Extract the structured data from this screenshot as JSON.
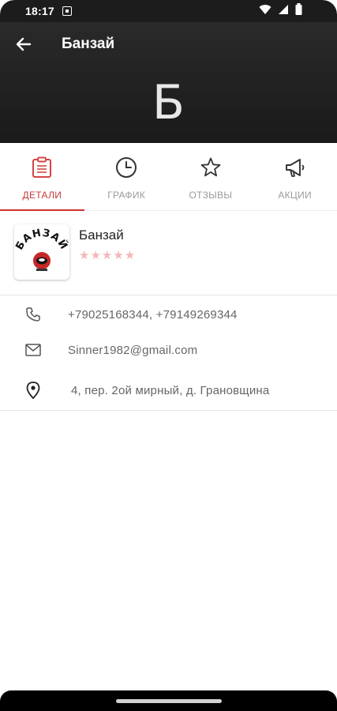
{
  "status_bar": {
    "time": "18:17",
    "icons": [
      "notification-icon",
      "wifi-icon",
      "signal-icon",
      "battery-icon"
    ]
  },
  "header": {
    "back_icon": "arrow-left-icon",
    "title": "Банзай",
    "initial": "Б"
  },
  "tabs": [
    {
      "label": "ДЕТАЛИ",
      "icon": "clipboard-icon",
      "active": true
    },
    {
      "label": "ГРАФИК",
      "icon": "clock-icon",
      "active": false
    },
    {
      "label": "ОТЗЫВЫ",
      "icon": "star-outline-icon",
      "active": false
    },
    {
      "label": "АКЦИИ",
      "icon": "megaphone-icon",
      "active": false
    }
  ],
  "profile": {
    "logo_text": "БАНЗАЙ",
    "name": "Банзай",
    "rating": 0,
    "stars": "★★★★★"
  },
  "contacts": {
    "phone": "+79025168344, +79149269344",
    "email": "Sinner1982@gmail.com",
    "address": "4, пер. 2ой мирный, д. Грановщина"
  },
  "colors": {
    "header_bg": "#1f1f1f",
    "accent": "#d32f2f",
    "star_empty": "#f2b8b8"
  }
}
